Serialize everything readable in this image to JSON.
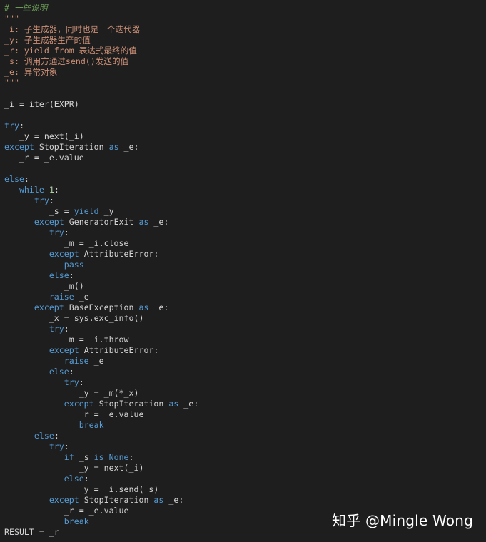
{
  "colors": {
    "background": "#1e1e1e",
    "keyword": "#569cd6",
    "comment": "#6a9955",
    "string": "#ce9178",
    "number": "#b5cea8",
    "text": "#d4d4d4"
  },
  "watermark": "知乎 @Mingle Wong",
  "code_lines": [
    [
      {
        "t": "# 一些说明",
        "k": "cm"
      }
    ],
    [
      {
        "t": "\"\"\"",
        "k": "st"
      }
    ],
    [
      {
        "t": "_i: 子生成器，同时也是一个迭代器",
        "k": "st"
      }
    ],
    [
      {
        "t": "_y: 子生成器生产的值",
        "k": "st"
      }
    ],
    [
      {
        "t": "_r: yield from 表达式最终的值",
        "k": "st"
      }
    ],
    [
      {
        "t": "_s: 调用方通过send()发送的值",
        "k": "st"
      }
    ],
    [
      {
        "t": "_e: 异常对象",
        "k": "st"
      }
    ],
    [
      {
        "t": "\"\"\"",
        "k": "st"
      }
    ],
    [],
    [
      {
        "t": "_i = iter(EXPR)",
        "k": "tok"
      }
    ],
    [],
    [
      {
        "t": "try",
        "k": "kw"
      },
      {
        "t": ":",
        "k": "tok"
      }
    ],
    [
      {
        "t": "   _y = next(_i)",
        "k": "tok"
      }
    ],
    [
      {
        "t": "except",
        "k": "kw"
      },
      {
        "t": " StopIteration ",
        "k": "tok"
      },
      {
        "t": "as",
        "k": "kw"
      },
      {
        "t": " _e:",
        "k": "tok"
      }
    ],
    [
      {
        "t": "   _r = _e.value",
        "k": "tok"
      }
    ],
    [],
    [
      {
        "t": "else",
        "k": "kw"
      },
      {
        "t": ":",
        "k": "tok"
      }
    ],
    [
      {
        "t": "   ",
        "k": "tok"
      },
      {
        "t": "while",
        "k": "kw"
      },
      {
        "t": " ",
        "k": "tok"
      },
      {
        "t": "1",
        "k": "nm"
      },
      {
        "t": ":",
        "k": "tok"
      }
    ],
    [
      {
        "t": "      ",
        "k": "tok"
      },
      {
        "t": "try",
        "k": "kw"
      },
      {
        "t": ":",
        "k": "tok"
      }
    ],
    [
      {
        "t": "         _s = ",
        "k": "tok"
      },
      {
        "t": "yield",
        "k": "kw"
      },
      {
        "t": " _y",
        "k": "tok"
      }
    ],
    [
      {
        "t": "      ",
        "k": "tok"
      },
      {
        "t": "except",
        "k": "kw"
      },
      {
        "t": " GeneratorExit ",
        "k": "tok"
      },
      {
        "t": "as",
        "k": "kw"
      },
      {
        "t": " _e:",
        "k": "tok"
      }
    ],
    [
      {
        "t": "         ",
        "k": "tok"
      },
      {
        "t": "try",
        "k": "kw"
      },
      {
        "t": ":",
        "k": "tok"
      }
    ],
    [
      {
        "t": "            _m = _i.close",
        "k": "tok"
      }
    ],
    [
      {
        "t": "         ",
        "k": "tok"
      },
      {
        "t": "except",
        "k": "kw"
      },
      {
        "t": " AttributeError:",
        "k": "tok"
      }
    ],
    [
      {
        "t": "            ",
        "k": "tok"
      },
      {
        "t": "pass",
        "k": "kw"
      }
    ],
    [
      {
        "t": "         ",
        "k": "tok"
      },
      {
        "t": "else",
        "k": "kw"
      },
      {
        "t": ":",
        "k": "tok"
      }
    ],
    [
      {
        "t": "            _m()",
        "k": "tok"
      }
    ],
    [
      {
        "t": "         ",
        "k": "tok"
      },
      {
        "t": "raise",
        "k": "kw"
      },
      {
        "t": " _e",
        "k": "tok"
      }
    ],
    [
      {
        "t": "      ",
        "k": "tok"
      },
      {
        "t": "except",
        "k": "kw"
      },
      {
        "t": " BaseException ",
        "k": "tok"
      },
      {
        "t": "as",
        "k": "kw"
      },
      {
        "t": " _e:",
        "k": "tok"
      }
    ],
    [
      {
        "t": "         _x = sys.exc_info()",
        "k": "tok"
      }
    ],
    [
      {
        "t": "         ",
        "k": "tok"
      },
      {
        "t": "try",
        "k": "kw"
      },
      {
        "t": ":",
        "k": "tok"
      }
    ],
    [
      {
        "t": "            _m = _i.throw",
        "k": "tok"
      }
    ],
    [
      {
        "t": "         ",
        "k": "tok"
      },
      {
        "t": "except",
        "k": "kw"
      },
      {
        "t": " AttributeError:",
        "k": "tok"
      }
    ],
    [
      {
        "t": "            ",
        "k": "tok"
      },
      {
        "t": "raise",
        "k": "kw"
      },
      {
        "t": " _e",
        "k": "tok"
      }
    ],
    [
      {
        "t": "         ",
        "k": "tok"
      },
      {
        "t": "else",
        "k": "kw"
      },
      {
        "t": ":",
        "k": "tok"
      }
    ],
    [
      {
        "t": "            ",
        "k": "tok"
      },
      {
        "t": "try",
        "k": "kw"
      },
      {
        "t": ":",
        "k": "tok"
      }
    ],
    [
      {
        "t": "               _y = _m(*_x)",
        "k": "tok"
      }
    ],
    [
      {
        "t": "            ",
        "k": "tok"
      },
      {
        "t": "except",
        "k": "kw"
      },
      {
        "t": " StopIteration ",
        "k": "tok"
      },
      {
        "t": "as",
        "k": "kw"
      },
      {
        "t": " _e:",
        "k": "tok"
      }
    ],
    [
      {
        "t": "               _r = _e.value",
        "k": "tok"
      }
    ],
    [
      {
        "t": "               ",
        "k": "tok"
      },
      {
        "t": "break",
        "k": "kw"
      }
    ],
    [
      {
        "t": "      ",
        "k": "tok"
      },
      {
        "t": "else",
        "k": "kw"
      },
      {
        "t": ":",
        "k": "tok"
      }
    ],
    [
      {
        "t": "         ",
        "k": "tok"
      },
      {
        "t": "try",
        "k": "kw"
      },
      {
        "t": ":",
        "k": "tok"
      }
    ],
    [
      {
        "t": "            ",
        "k": "tok"
      },
      {
        "t": "if",
        "k": "kw"
      },
      {
        "t": " _s ",
        "k": "tok"
      },
      {
        "t": "is",
        "k": "kw"
      },
      {
        "t": " ",
        "k": "tok"
      },
      {
        "t": "None",
        "k": "kw"
      },
      {
        "t": ":",
        "k": "tok"
      }
    ],
    [
      {
        "t": "               _y = next(_i)",
        "k": "tok"
      }
    ],
    [
      {
        "t": "            ",
        "k": "tok"
      },
      {
        "t": "else",
        "k": "kw"
      },
      {
        "t": ":",
        "k": "tok"
      }
    ],
    [
      {
        "t": "               _y = _i.send(_s)",
        "k": "tok"
      }
    ],
    [
      {
        "t": "         ",
        "k": "tok"
      },
      {
        "t": "except",
        "k": "kw"
      },
      {
        "t": " StopIteration ",
        "k": "tok"
      },
      {
        "t": "as",
        "k": "kw"
      },
      {
        "t": " _e:",
        "k": "tok"
      }
    ],
    [
      {
        "t": "            _r = _e.value",
        "k": "tok"
      }
    ],
    [
      {
        "t": "            ",
        "k": "tok"
      },
      {
        "t": "break",
        "k": "kw"
      }
    ],
    [
      {
        "t": "RESULT = _r",
        "k": "tok"
      }
    ]
  ]
}
